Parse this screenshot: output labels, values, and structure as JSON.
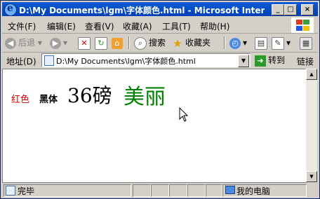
{
  "window": {
    "title": "D:\\My Documents\\lgm\\字体颜色.html - Microsoft Internet Explo..."
  },
  "window_controls": {
    "minimize": "_",
    "maximize": "□",
    "close": "×"
  },
  "menubar": {
    "items": [
      "文件(F)",
      "编辑(E)",
      "查看(V)",
      "收藏(A)",
      "工具(T)",
      "帮助(H)"
    ]
  },
  "toolbar": {
    "back": "后退",
    "search": "搜索",
    "favorites": "收藏夹"
  },
  "address": {
    "label": "地址(D)",
    "value": "D:\\My Documents\\lgm\\字体颜色.html",
    "go": "转到",
    "links": "链接"
  },
  "page": {
    "red_text": "红色",
    "bold_text": "黑体",
    "size_text": "36磅",
    "green_text": "美丽"
  },
  "status": {
    "text": "完毕",
    "zone": "我的电脑"
  },
  "colors": {
    "red": "#cc0000",
    "green": "#008000",
    "titlebar": "#0a5bd6"
  }
}
